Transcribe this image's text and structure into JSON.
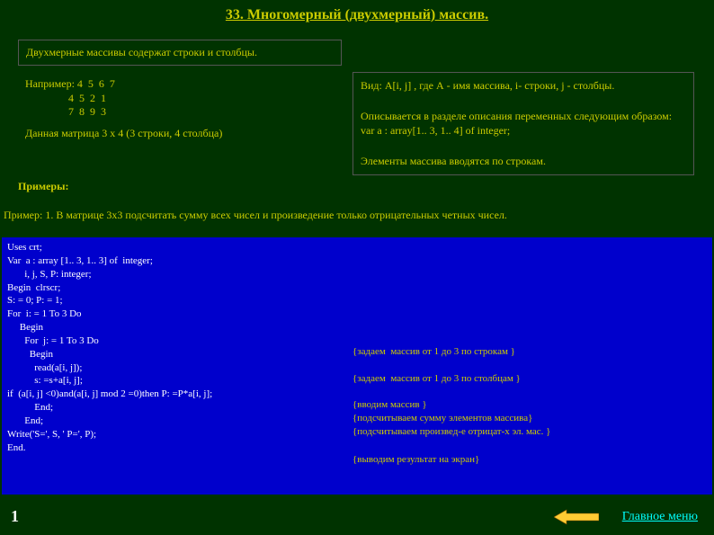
{
  "title": "33. Многомерный (двухмерный) массив.",
  "topbox1": "Двухмерные массивы содержат строки и столбцы.",
  "matrix": "Например: 4  5  6  7\n                4  5  2  1\n                7  8  9  3",
  "matrix_caption": "Данная матрица 3 x 4 (3 строки, 4 столбца)",
  "description": {
    "line1": "Вид:  A[i, j]  , где  А - имя массива, i- строки, j - столбцы.",
    "line2": "Описывается в разделе описания переменных следующим образом:",
    "line3": "  var a : array[1.. 3, 1.. 4] of  integer;",
    "line4": "Элементы массива вводятся по строкам."
  },
  "examples_label": "Примеры:",
  "example1": "Пример: 1.  В матрице 3x3  подсчитать сумму всех чисел и произведение только отрицательных четных чисел.",
  "code_left": "Uses crt;\nVar  a : array [1.. 3, 1.. 3] of  integer;\n       i, j, S, P: integer;\nBegin  clrscr;\nS: = 0; P: = 1;\nFor  i: = 1 To 3 Do\n     Begin\n       For  j: = 1 To 3 Do\n         Begin\n           read(a[i, j]);\n           s: =s+a[i, j];\nif  (a[i, j] <0)and(a[i, j] mod 2 =0)then P: =P*a[i, j];\n           End;\n       End;\nWrite('S=', S, ' P=', P);\nEnd.",
  "code_right": "{задаем  массив от 1 до 3 по строкам }\n\n{задаем  массив от 1 до 3 по столбцам }\n\n{вводим массив }\n{подсчитываем сумму элементов массива}\n{подсчитываем произвед-е отрицат-x эл. мас. }",
  "code_right2": "{выводим результат на экран}",
  "page_num": "1",
  "mainmenu": "Главное меню"
}
